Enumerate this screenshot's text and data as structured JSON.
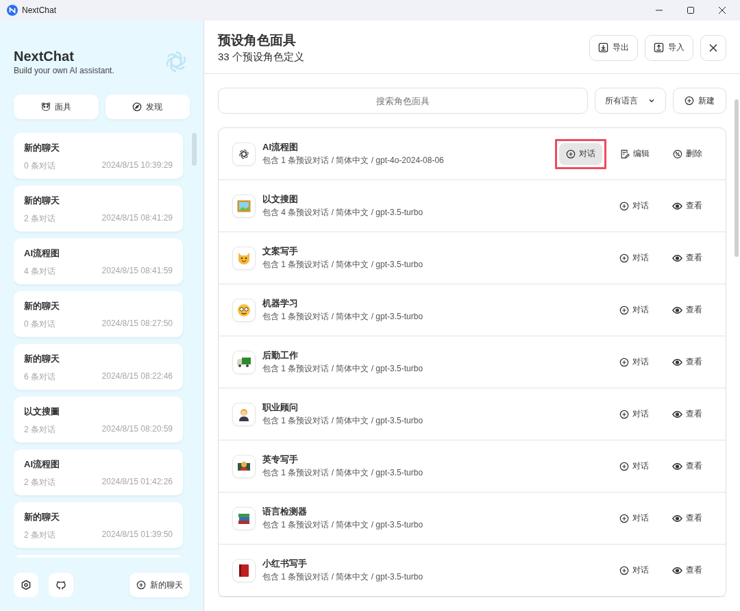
{
  "window": {
    "title": "NextChat"
  },
  "sidebar": {
    "title": "NextChat",
    "subtitle": "Build your own AI assistant.",
    "buttons": [
      {
        "kind": "mask",
        "label": "面具"
      },
      {
        "kind": "discover",
        "label": "发现"
      }
    ],
    "chats": [
      {
        "title": "新的聊天",
        "count": "0 条对话",
        "time": "2024/8/15 10:39:29"
      },
      {
        "title": "新的聊天",
        "count": "2 条对话",
        "time": "2024/8/15 08:41:29"
      },
      {
        "title": "AI流程图",
        "count": "4 条对话",
        "time": "2024/8/15 08:41:59"
      },
      {
        "title": "新的聊天",
        "count": "0 条对话",
        "time": "2024/8/15 08:27:50"
      },
      {
        "title": "新的聊天",
        "count": "6 条对话",
        "time": "2024/8/15 08:22:46"
      },
      {
        "title": "以文搜圖",
        "count": "2 条对话",
        "time": "2024/8/15 08:20:59"
      },
      {
        "title": "AI流程图",
        "count": "2 条对话",
        "time": "2024/8/15 01:42:26"
      },
      {
        "title": "新的聊天",
        "count": "2 条对话",
        "time": "2024/8/15 01:39:50"
      }
    ],
    "new_chat": "新的聊天"
  },
  "header": {
    "title": "预设角色面具",
    "subtitle": "33 个预设角色定义",
    "buttons": [
      {
        "kind": "export",
        "label": "导出"
      },
      {
        "kind": "import",
        "label": "导入"
      }
    ]
  },
  "search": {
    "placeholder": "搜索角色面具"
  },
  "language": {
    "value": "所有语言"
  },
  "new_button": "新建",
  "masks": [
    {
      "kind": "openai",
      "name": "AI流程图",
      "info": "包含 1 条预设对话 / 简体中文 / gpt-4o-2024-08-06",
      "actions": [
        {
          "kind": "chat",
          "label": "对话",
          "hovered": true
        },
        {
          "kind": "edit",
          "label": "编辑",
          "hovered": false
        },
        {
          "kind": "delete",
          "label": "删除",
          "hovered": false
        }
      ]
    },
    {
      "kind": "picture",
      "name": "以文搜图",
      "info": "包含 4 条预设对话 / 简体中文 / gpt-3.5-turbo",
      "actions": [
        {
          "kind": "chat",
          "label": "对话",
          "hovered": false
        },
        {
          "kind": "view",
          "label": "查看",
          "hovered": false
        }
      ]
    },
    {
      "kind": "cat",
      "name": "文案写手",
      "info": "包含 1 条预设对话 / 简体中文 / gpt-3.5-turbo",
      "actions": [
        {
          "kind": "chat",
          "label": "对话",
          "hovered": false
        },
        {
          "kind": "view",
          "label": "查看",
          "hovered": false
        }
      ]
    },
    {
      "kind": "nerd",
      "name": "机器学习",
      "info": "包含 1 条预设对话 / 简体中文 / gpt-3.5-turbo",
      "actions": [
        {
          "kind": "chat",
          "label": "对话",
          "hovered": false
        },
        {
          "kind": "view",
          "label": "查看",
          "hovered": false
        }
      ]
    },
    {
      "kind": "truck",
      "name": "后勤工作",
      "info": "包含 1 条预设对话 / 简体中文 / gpt-3.5-turbo",
      "actions": [
        {
          "kind": "chat",
          "label": "对话",
          "hovered": false
        },
        {
          "kind": "view",
          "label": "查看",
          "hovered": false
        }
      ]
    },
    {
      "kind": "person",
      "name": "职业顾问",
      "info": "包含 1 条预设对话 / 简体中文 / gpt-3.5-turbo",
      "actions": [
        {
          "kind": "chat",
          "label": "对话",
          "hovered": false
        },
        {
          "kind": "view",
          "label": "查看",
          "hovered": false
        }
      ]
    },
    {
      "kind": "teacher",
      "name": "英专写手",
      "info": "包含 1 条预设对话 / 简体中文 / gpt-3.5-turbo",
      "actions": [
        {
          "kind": "chat",
          "label": "对话",
          "hovered": false
        },
        {
          "kind": "view",
          "label": "查看",
          "hovered": false
        }
      ]
    },
    {
      "kind": "books",
      "name": "语言检测器",
      "info": "包含 1 条预设对话 / 简体中文 / gpt-3.5-turbo",
      "actions": [
        {
          "kind": "chat",
          "label": "对话",
          "hovered": false
        },
        {
          "kind": "view",
          "label": "查看",
          "hovered": false
        }
      ]
    },
    {
      "kind": "book",
      "name": "小红书写手",
      "info": "包含 1 条预设对话 / 简体中文 / gpt-3.5-turbo",
      "actions": [
        {
          "kind": "chat",
          "label": "对话",
          "hovered": false
        },
        {
          "kind": "view",
          "label": "查看",
          "hovered": false
        }
      ]
    }
  ]
}
